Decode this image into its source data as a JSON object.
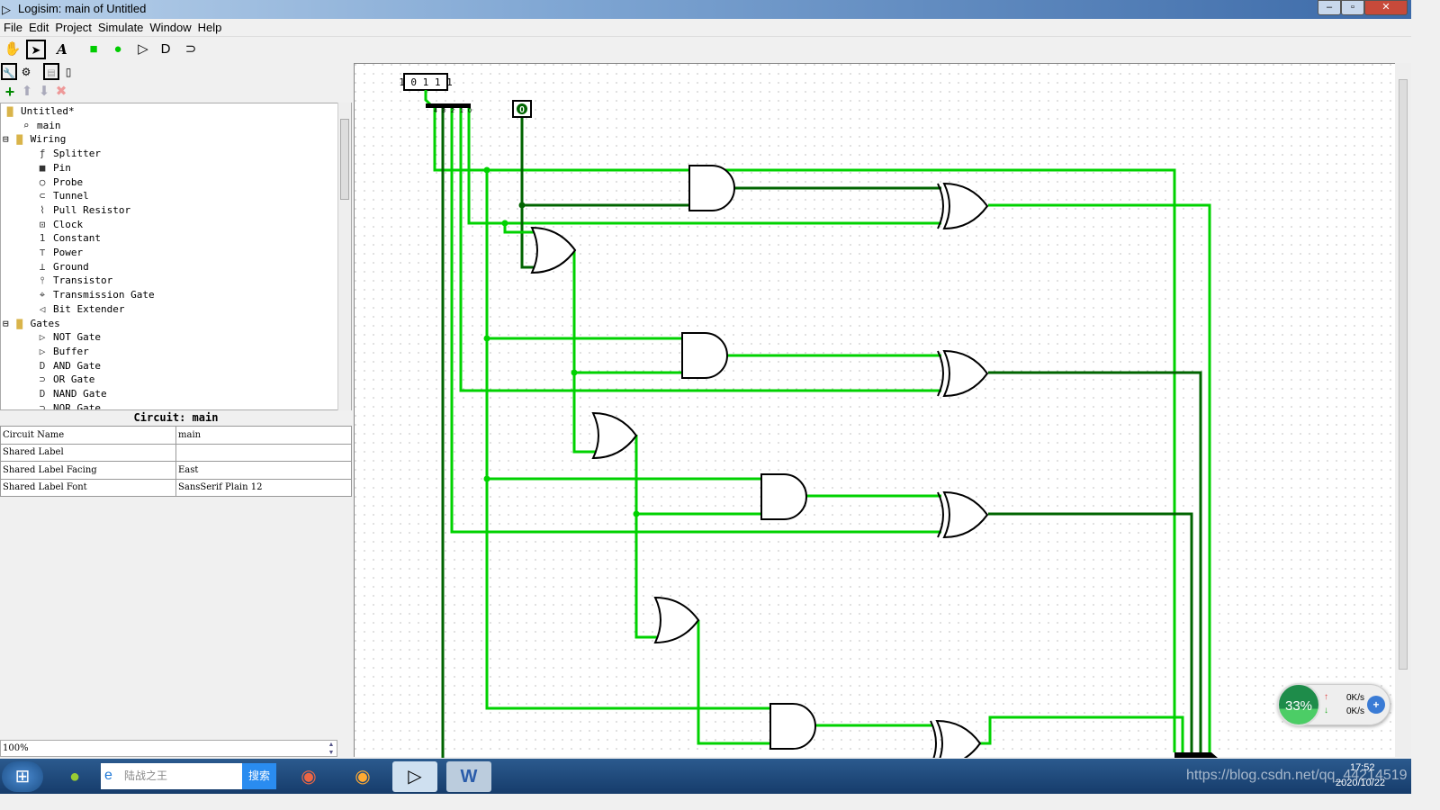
{
  "window": {
    "title": "Logisim: main of Untitled",
    "controls": [
      "–",
      "▫",
      "✕"
    ]
  },
  "menu": [
    "File",
    "Edit",
    "Project",
    "Simulate",
    "Window",
    "Help"
  ],
  "toolbar": {
    "tools": [
      {
        "icon": "hand-poke-icon",
        "glyph": "✋"
      },
      {
        "icon": "select-arrow-icon",
        "glyph": "➤"
      },
      {
        "icon": "text-tool-icon",
        "glyph": "A"
      },
      {
        "icon": "input-pin-icon",
        "glyph": "■"
      },
      {
        "icon": "output-pin-icon",
        "glyph": "●"
      },
      {
        "icon": "not-gate-icon",
        "glyph": "▷"
      },
      {
        "icon": "and-gate-icon",
        "glyph": "D"
      },
      {
        "icon": "or-gate-icon",
        "glyph": "⊃"
      }
    ]
  },
  "explorer": {
    "tree": [
      {
        "label": "Untitled*",
        "level": 0,
        "icon": "▇"
      },
      {
        "label": "main",
        "level": 1,
        "icon": "⌕"
      },
      {
        "label": "Wiring",
        "level": 1,
        "icon": "▇",
        "expander": "⊟"
      },
      {
        "label": "Splitter",
        "level": 2,
        "icon": "ƒ"
      },
      {
        "label": "Pin",
        "level": 2,
        "icon": "■"
      },
      {
        "label": "Probe",
        "level": 2,
        "icon": "○"
      },
      {
        "label": "Tunnel",
        "level": 2,
        "icon": "⊂"
      },
      {
        "label": "Pull Resistor",
        "level": 2,
        "icon": "⌇"
      },
      {
        "label": "Clock",
        "level": 2,
        "icon": "⊡"
      },
      {
        "label": "Constant",
        "level": 2,
        "icon": "1"
      },
      {
        "label": "Power",
        "level": 2,
        "icon": "⊤"
      },
      {
        "label": "Ground",
        "level": 2,
        "icon": "⊥"
      },
      {
        "label": "Transistor",
        "level": 2,
        "icon": "⫯"
      },
      {
        "label": "Transmission Gate",
        "level": 2,
        "icon": "⌖"
      },
      {
        "label": "Bit Extender",
        "level": 2,
        "icon": "◁"
      },
      {
        "label": "Gates",
        "level": 1,
        "icon": "▇",
        "expander": "⊟"
      },
      {
        "label": "NOT Gate",
        "level": 2,
        "icon": "▷"
      },
      {
        "label": "Buffer",
        "level": 2,
        "icon": "▷"
      },
      {
        "label": "AND Gate",
        "level": 2,
        "icon": "D"
      },
      {
        "label": "OR Gate",
        "level": 2,
        "icon": "⊃"
      },
      {
        "label": "NAND Gate",
        "level": 2,
        "icon": "D"
      },
      {
        "label": "NOR Gate",
        "level": 2,
        "icon": "⊃"
      }
    ]
  },
  "properties": {
    "title": "Circuit: main",
    "rows": [
      [
        "Circuit Name",
        "main"
      ],
      [
        "Shared Label",
        ""
      ],
      [
        "Shared Label Facing",
        "East"
      ],
      [
        "Shared Label Font",
        "SansSerif Plain 12"
      ]
    ]
  },
  "zoom": "100%",
  "circuit": {
    "input_pin": "1 0 1 1 1",
    "constant": "0",
    "splitter_bits": [
      "4",
      "3",
      "2",
      "1",
      "0"
    ],
    "wire_on": "#00d200",
    "wire_off": "#006400"
  },
  "net_widget": {
    "percent": "33%",
    "up": "0K/s",
    "down": "0K/s"
  },
  "taskbar": {
    "search_placeholder": "陆战之王",
    "search_button": "搜索",
    "clock_time": "17:52",
    "clock_date": "2020/10/22",
    "watermark": "https://blog.csdn.net/qq_44214519"
  }
}
